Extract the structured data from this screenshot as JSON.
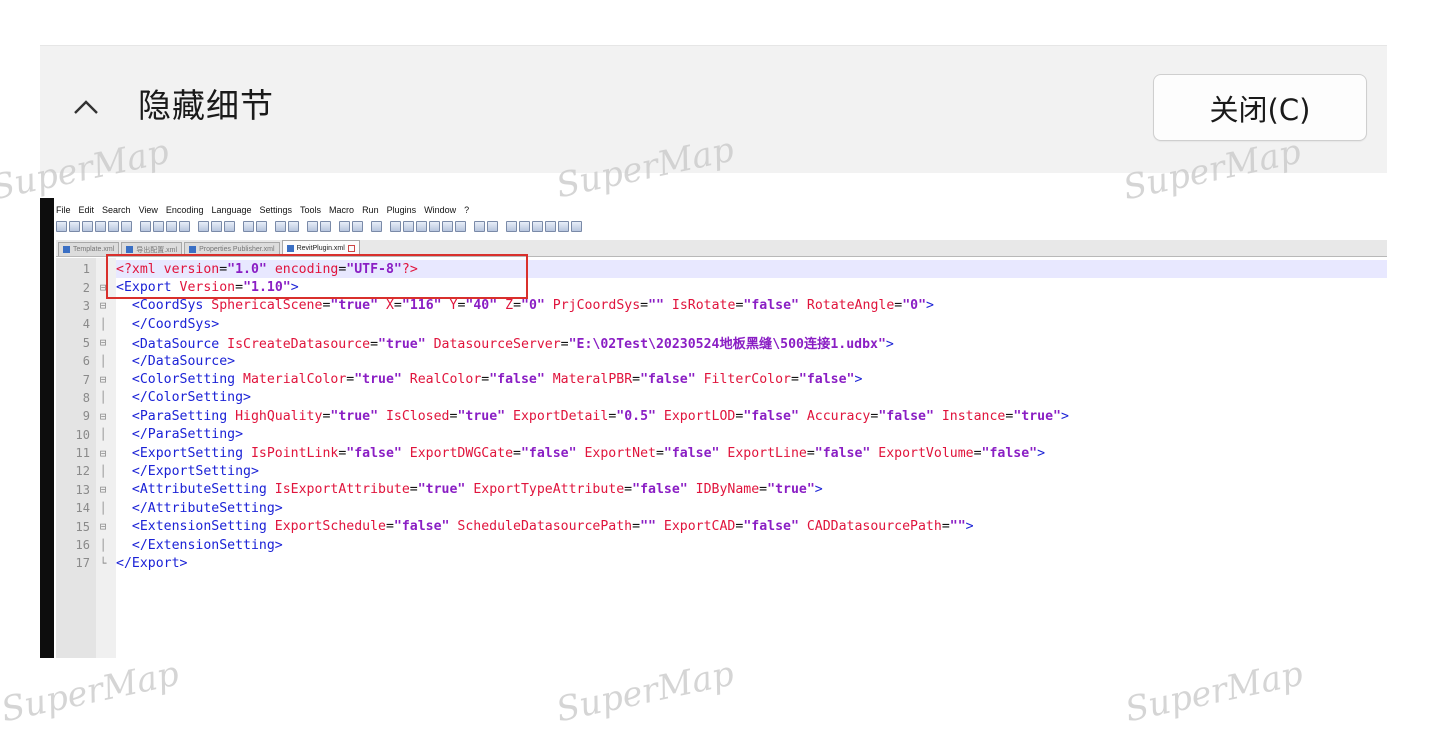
{
  "dialog": {
    "toggle_label": "隐藏细节",
    "close_label": "关闭(C)"
  },
  "editor": {
    "menu": [
      "File",
      "Edit",
      "Search",
      "View",
      "Encoding",
      "Language",
      "Settings",
      "Tools",
      "Macro",
      "Run",
      "Plugins",
      "Window",
      "?"
    ],
    "tabs": [
      {
        "label": "Template.xml"
      },
      {
        "label": "导出配置.xml"
      },
      {
        "label": "Properties Publisher.xml"
      },
      {
        "label": "RevitPlugin.xml",
        "active": true
      }
    ],
    "lines": [
      {
        "n": "1",
        "fold": "",
        "segments": [
          [
            "pi",
            "<?xml "
          ],
          [
            "attr",
            "version"
          ],
          [
            "eq",
            "="
          ],
          [
            "val",
            "\"1.0\""
          ],
          [
            "attr",
            " encoding"
          ],
          [
            "eq",
            "="
          ],
          [
            "val",
            "\"UTF-8\""
          ],
          [
            "pi",
            "?>"
          ]
        ]
      },
      {
        "n": "2",
        "fold": "⊟",
        "segments": [
          [
            "tag",
            "<Export "
          ],
          [
            "attr",
            "Version"
          ],
          [
            "eq",
            "="
          ],
          [
            "val",
            "\"1.10\""
          ],
          [
            "tag",
            ">"
          ]
        ]
      },
      {
        "n": "3",
        "fold": "⊟",
        "segments": [
          [
            "tag",
            "  <CoordSys "
          ],
          [
            "attr",
            "SphericalScene"
          ],
          [
            "eq",
            "="
          ],
          [
            "val",
            "\"true\""
          ],
          [
            "attr",
            " X"
          ],
          [
            "eq",
            "="
          ],
          [
            "val",
            "\"116\""
          ],
          [
            "attr",
            " Y"
          ],
          [
            "eq",
            "="
          ],
          [
            "val",
            "\"40\""
          ],
          [
            "attr",
            " Z"
          ],
          [
            "eq",
            "="
          ],
          [
            "val",
            "\"0\""
          ],
          [
            "attr",
            " PrjCoordSys"
          ],
          [
            "eq",
            "="
          ],
          [
            "val",
            "\"\""
          ],
          [
            "attr",
            " IsRotate"
          ],
          [
            "eq",
            "="
          ],
          [
            "val",
            "\"false\""
          ],
          [
            "attr",
            " RotateAngle"
          ],
          [
            "eq",
            "="
          ],
          [
            "val",
            "\"0\""
          ],
          [
            "tag",
            ">"
          ]
        ]
      },
      {
        "n": "4",
        "fold": "│",
        "segments": [
          [
            "tag",
            "  </CoordSys>"
          ]
        ]
      },
      {
        "n": "5",
        "fold": "⊟",
        "segments": [
          [
            "tag",
            "  <DataSource "
          ],
          [
            "attr",
            "IsCreateDatasource"
          ],
          [
            "eq",
            "="
          ],
          [
            "val",
            "\"true\""
          ],
          [
            "attr",
            " DatasourceServer"
          ],
          [
            "eq",
            "="
          ],
          [
            "val",
            "\"E:\\02Test\\20230524地板黑缝\\500连接1.udbx\""
          ],
          [
            "tag",
            ">"
          ]
        ]
      },
      {
        "n": "6",
        "fold": "│",
        "segments": [
          [
            "tag",
            "  </DataSource>"
          ]
        ]
      },
      {
        "n": "7",
        "fold": "⊟",
        "segments": [
          [
            "tag",
            "  <ColorSetting "
          ],
          [
            "attr",
            "MaterialColor"
          ],
          [
            "eq",
            "="
          ],
          [
            "val",
            "\"true\""
          ],
          [
            "attr",
            " RealColor"
          ],
          [
            "eq",
            "="
          ],
          [
            "val",
            "\"false\""
          ],
          [
            "attr",
            " MateralPBR"
          ],
          [
            "eq",
            "="
          ],
          [
            "val",
            "\"false\""
          ],
          [
            "attr",
            " FilterColor"
          ],
          [
            "eq",
            "="
          ],
          [
            "val",
            "\"false\""
          ],
          [
            "tag",
            ">"
          ]
        ]
      },
      {
        "n": "8",
        "fold": "│",
        "segments": [
          [
            "tag",
            "  </ColorSetting>"
          ]
        ]
      },
      {
        "n": "9",
        "fold": "⊟",
        "segments": [
          [
            "tag",
            "  <ParaSetting "
          ],
          [
            "attr",
            "HighQuality"
          ],
          [
            "eq",
            "="
          ],
          [
            "val",
            "\"true\""
          ],
          [
            "attr",
            " IsClosed"
          ],
          [
            "eq",
            "="
          ],
          [
            "val",
            "\"true\""
          ],
          [
            "attr",
            " ExportDetail"
          ],
          [
            "eq",
            "="
          ],
          [
            "val",
            "\"0.5\""
          ],
          [
            "attr",
            " ExportLOD"
          ],
          [
            "eq",
            "="
          ],
          [
            "val",
            "\"false\""
          ],
          [
            "attr",
            " Accuracy"
          ],
          [
            "eq",
            "="
          ],
          [
            "val",
            "\"false\""
          ],
          [
            "attr",
            " Instance"
          ],
          [
            "eq",
            "="
          ],
          [
            "val",
            "\"true\""
          ],
          [
            "tag",
            ">"
          ]
        ]
      },
      {
        "n": "10",
        "fold": "│",
        "segments": [
          [
            "tag",
            "  </ParaSetting>"
          ]
        ]
      },
      {
        "n": "11",
        "fold": "⊟",
        "segments": [
          [
            "tag",
            "  <ExportSetting "
          ],
          [
            "attr",
            "IsPointLink"
          ],
          [
            "eq",
            "="
          ],
          [
            "val",
            "\"false\""
          ],
          [
            "attr",
            " ExportDWGCate"
          ],
          [
            "eq",
            "="
          ],
          [
            "val",
            "\"false\""
          ],
          [
            "attr",
            " ExportNet"
          ],
          [
            "eq",
            "="
          ],
          [
            "val",
            "\"false\""
          ],
          [
            "attr",
            " ExportLine"
          ],
          [
            "eq",
            "="
          ],
          [
            "val",
            "\"false\""
          ],
          [
            "attr",
            " ExportVolume"
          ],
          [
            "eq",
            "="
          ],
          [
            "val",
            "\"false\""
          ],
          [
            "tag",
            ">"
          ]
        ]
      },
      {
        "n": "12",
        "fold": "│",
        "segments": [
          [
            "tag",
            "  </ExportSetting>"
          ]
        ]
      },
      {
        "n": "13",
        "fold": "⊟",
        "segments": [
          [
            "tag",
            "  <AttributeSetting "
          ],
          [
            "attr",
            "IsExportAttribute"
          ],
          [
            "eq",
            "="
          ],
          [
            "val",
            "\"true\""
          ],
          [
            "attr",
            " ExportTypeAttribute"
          ],
          [
            "eq",
            "="
          ],
          [
            "val",
            "\"false\""
          ],
          [
            "attr",
            " IDByName"
          ],
          [
            "eq",
            "="
          ],
          [
            "val",
            "\"true\""
          ],
          [
            "tag",
            ">"
          ]
        ]
      },
      {
        "n": "14",
        "fold": "│",
        "segments": [
          [
            "tag",
            "  </AttributeSetting>"
          ]
        ]
      },
      {
        "n": "15",
        "fold": "⊟",
        "segments": [
          [
            "tag",
            "  <ExtensionSetting "
          ],
          [
            "attr",
            "ExportSchedule"
          ],
          [
            "eq",
            "="
          ],
          [
            "val",
            "\"false\""
          ],
          [
            "attr",
            " ScheduleDatasourcePath"
          ],
          [
            "eq",
            "="
          ],
          [
            "val",
            "\"\""
          ],
          [
            "attr",
            " ExportCAD"
          ],
          [
            "eq",
            "="
          ],
          [
            "val",
            "\"false\""
          ],
          [
            "attr",
            " CADDatasourcePath"
          ],
          [
            "eq",
            "="
          ],
          [
            "val",
            "\"\""
          ],
          [
            "tag",
            ">"
          ]
        ]
      },
      {
        "n": "16",
        "fold": "│",
        "segments": [
          [
            "tag",
            "  </ExtensionSetting>"
          ]
        ]
      },
      {
        "n": "17",
        "fold": "└",
        "segments": [
          [
            "tag",
            "</Export>"
          ]
        ]
      }
    ]
  },
  "watermark": "SuperMap",
  "colors": {
    "tag": "#1b22d6",
    "attribute": "#e0143c",
    "value": "#8a1ec4",
    "highlight_box": "#d9302c"
  }
}
